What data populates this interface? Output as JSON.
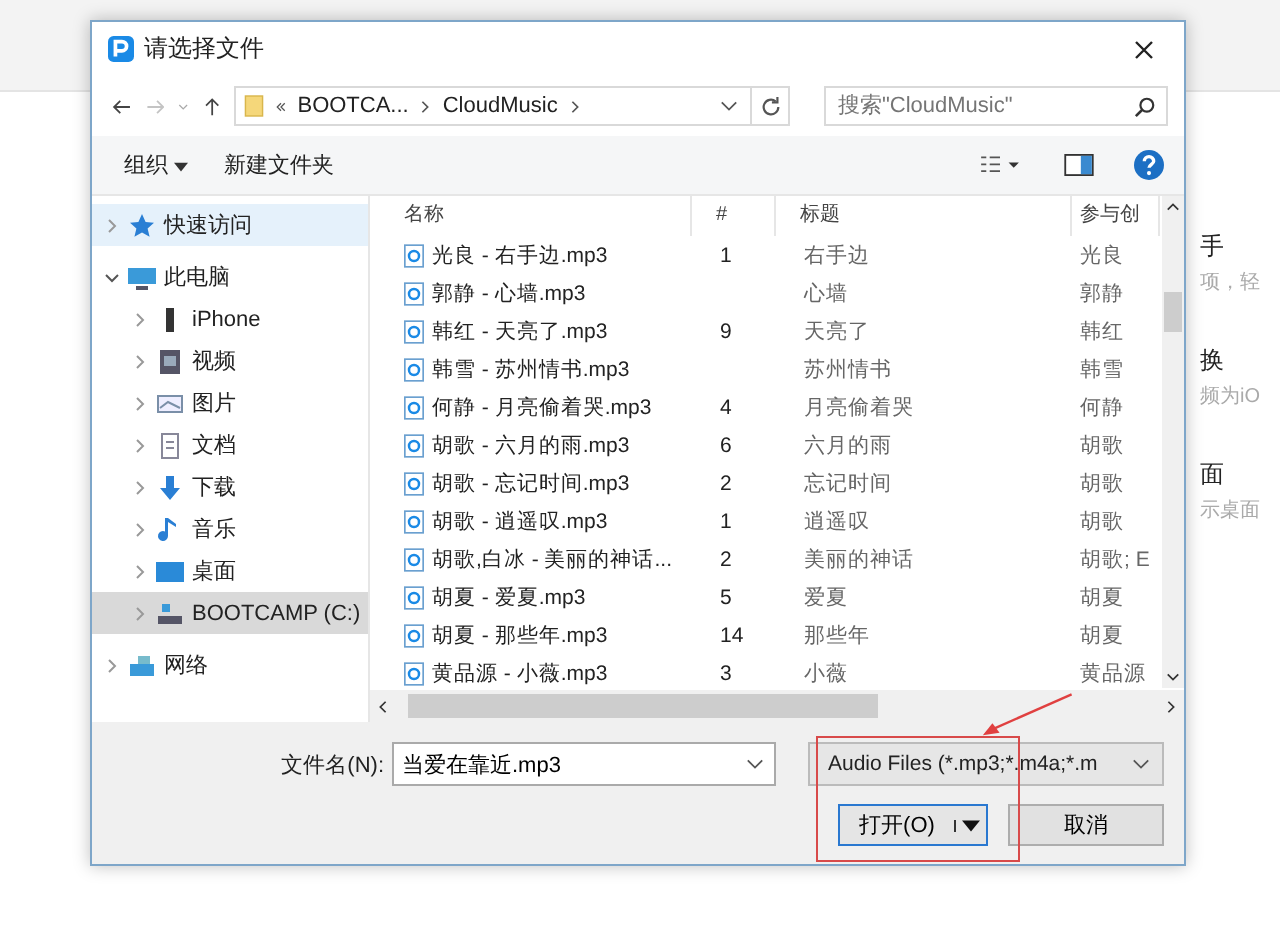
{
  "background": {
    "side_texts": [
      {
        "text": "手",
        "kind": "title"
      },
      {
        "text": "项，轻",
        "kind": "desc"
      },
      {
        "text": "换",
        "kind": "title"
      },
      {
        "text": "频为iO",
        "kind": "desc"
      },
      {
        "text": "面",
        "kind": "title"
      },
      {
        "text": "示桌面",
        "kind": "desc"
      }
    ]
  },
  "window": {
    "title": "请选择文件"
  },
  "address": {
    "path": [
      "BOOTCA...",
      "CloudMusic"
    ],
    "search_placeholder": "搜索\"CloudMusic\""
  },
  "toolbar": {
    "organize": "组织",
    "new_folder": "新建文件夹"
  },
  "nav": [
    {
      "label": "快速访问",
      "expanded": false,
      "selected": false
    },
    {
      "label": "此电脑",
      "expanded": true,
      "selected": false,
      "children": [
        {
          "label": "iPhone",
          "expanded": false,
          "selected": false
        },
        {
          "label": "视频",
          "expanded": false,
          "selected": false
        },
        {
          "label": "图片",
          "expanded": false,
          "selected": false
        },
        {
          "label": "文档",
          "expanded": false,
          "selected": false
        },
        {
          "label": "下载",
          "expanded": false,
          "selected": false
        },
        {
          "label": "音乐",
          "expanded": false,
          "selected": false
        },
        {
          "label": "桌面",
          "expanded": false,
          "selected": false
        },
        {
          "label": "BOOTCAMP (C:)",
          "expanded": false,
          "selected": true
        }
      ]
    },
    {
      "label": "网络",
      "expanded": false,
      "selected": false
    }
  ],
  "table": {
    "columns": [
      "名称",
      "#",
      "标题",
      "参与创"
    ],
    "rows": [
      {
        "name": "光良 - 右手边.mp3",
        "num": "1",
        "title": "右手边",
        "artist": "光良"
      },
      {
        "name": "郭静 - 心墙.mp3",
        "num": "",
        "title": "心墙",
        "artist": "郭静"
      },
      {
        "name": "韩红 - 天亮了.mp3",
        "num": "9",
        "title": "天亮了",
        "artist": "韩红"
      },
      {
        "name": "韩雪 - 苏州情书.mp3",
        "num": "",
        "title": "苏州情书",
        "artist": "韩雪"
      },
      {
        "name": "何静 - 月亮偷着哭.mp3",
        "num": "4",
        "title": "月亮偷着哭",
        "artist": "何静"
      },
      {
        "name": "胡歌 - 六月的雨.mp3",
        "num": "6",
        "title": "六月的雨",
        "artist": "胡歌"
      },
      {
        "name": "胡歌 - 忘记时间.mp3",
        "num": "2",
        "title": "忘记时间",
        "artist": "胡歌"
      },
      {
        "name": "胡歌 - 逍遥叹.mp3",
        "num": "1",
        "title": "逍遥叹",
        "artist": "胡歌"
      },
      {
        "name": "胡歌,白冰 - 美丽的神话...",
        "num": "2",
        "title": "美丽的神话",
        "artist": "胡歌; E"
      },
      {
        "name": "胡夏 - 爱夏.mp3",
        "num": "5",
        "title": "爱夏",
        "artist": "胡夏"
      },
      {
        "name": "胡夏 - 那些年.mp3",
        "num": "14",
        "title": "那些年",
        "artist": "胡夏"
      },
      {
        "name": "黄品源 - 小薇.mp3",
        "num": "3",
        "title": "小薇",
        "artist": "黄品源"
      }
    ]
  },
  "footer": {
    "filename_label": "文件名(N):",
    "filename": "当爱在靠近.mp3",
    "filter": "Audio Files (*.mp3;*.m4a;*.m",
    "open": "打开(O)",
    "cancel": "取消"
  }
}
